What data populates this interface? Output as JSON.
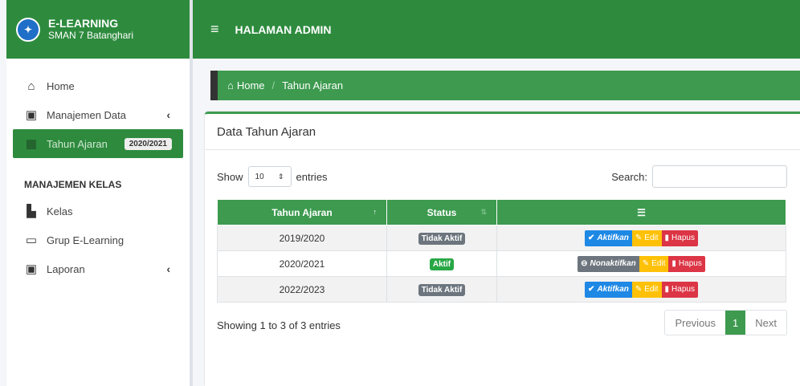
{
  "brand": {
    "title": "E-LEARNING",
    "subtitle": "SMAN 7 Batanghari"
  },
  "topbar": {
    "title": "HALAMAN ADMIN"
  },
  "sidebar": {
    "items": [
      {
        "label": "Home",
        "icon": "home-icon"
      },
      {
        "label": "Manajemen Data",
        "icon": "clipboard-icon"
      },
      {
        "label": "Tahun Ajaran",
        "icon": "calendar-icon",
        "badge": "2020/2021"
      }
    ],
    "section_header": "MANAJEMEN KELAS",
    "items2": [
      {
        "label": "Kelas",
        "icon": "classroom-icon"
      },
      {
        "label": "Grup E-Learning",
        "icon": "chat-group-icon"
      },
      {
        "label": "Laporan",
        "icon": "clipboard-icon"
      }
    ]
  },
  "breadcrumb": {
    "home": "Home",
    "current": "Tahun Ajaran"
  },
  "card": {
    "title": "Data Tahun Ajaran"
  },
  "table_controls": {
    "show": "Show",
    "entries_value": "10",
    "entries": "entries",
    "search_label": "Search:"
  },
  "table": {
    "headers": {
      "year": "Tahun Ajaran",
      "status": "Status"
    },
    "rows": [
      {
        "year": "2019/2020",
        "status": "Tidak Aktif",
        "toggle": "Aktifkan"
      },
      {
        "year": "2020/2021",
        "status": "Aktif",
        "toggle": "Nonaktifkan"
      },
      {
        "year": "2022/2023",
        "status": "Tidak Aktif",
        "toggle": "Aktifkan"
      }
    ],
    "edit_label": "Edit",
    "delete_label": "Hapus"
  },
  "footer": {
    "info": "Showing 1 to 3 of 3 entries"
  },
  "pagination": {
    "previous": "Previous",
    "current": "1",
    "next": "Next"
  },
  "colors": {
    "brand_green": "#2e8b3e",
    "header_green": "#3d9a4f",
    "primary_blue": "#1e88e5",
    "warning": "#ffc107",
    "danger": "#dc3545"
  }
}
